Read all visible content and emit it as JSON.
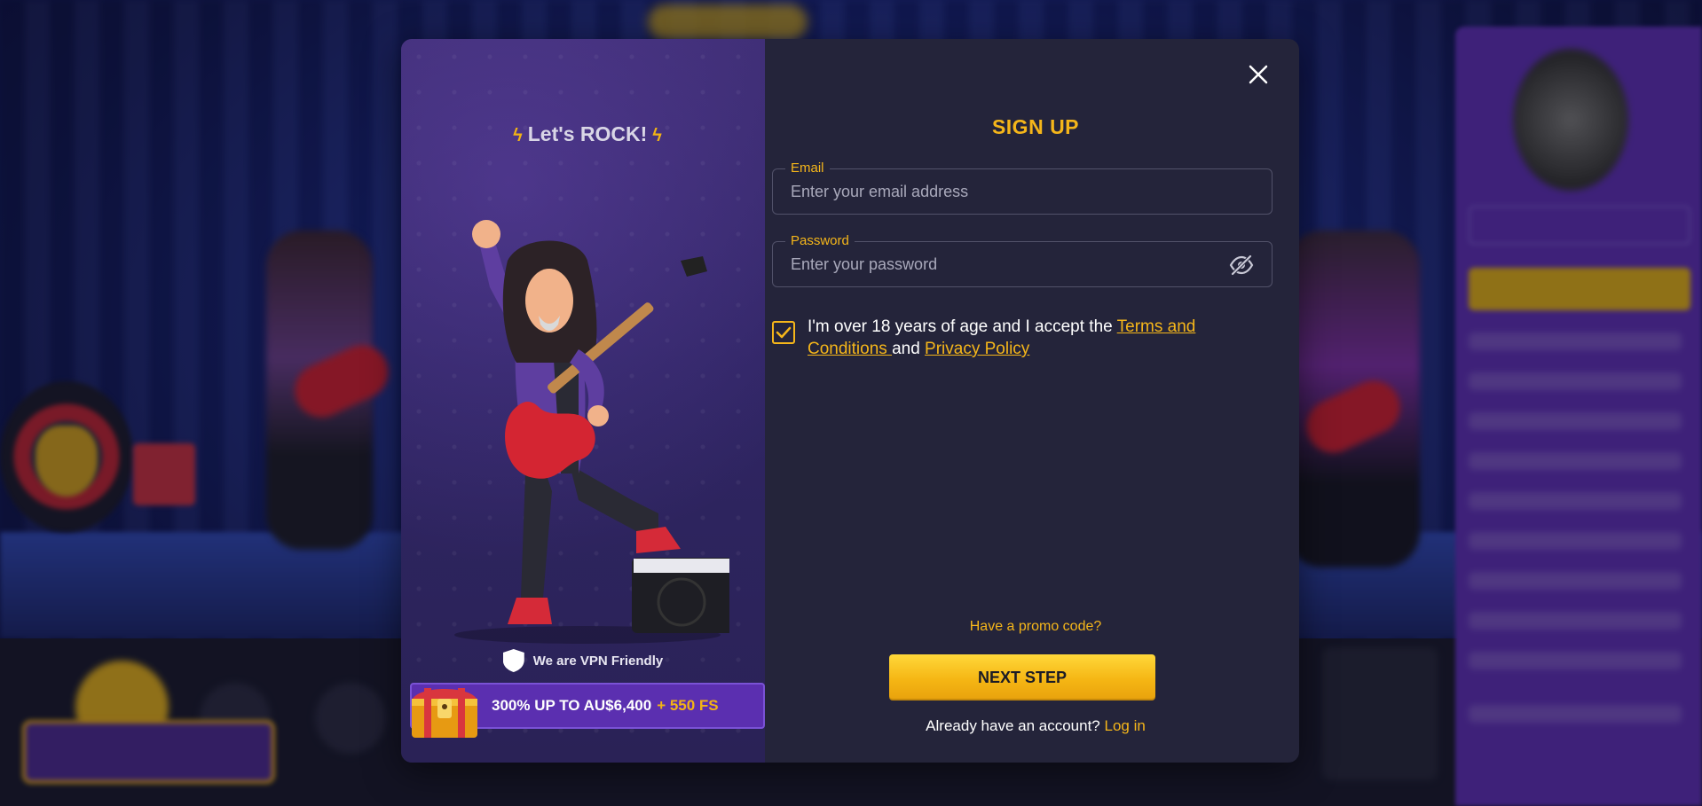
{
  "colors": {
    "accent": "#f5b61a",
    "modal_bg": "#24243a",
    "promo_panel": "#2f2563",
    "banner": "#5b2fb0"
  },
  "promo": {
    "headline": "Let's ROCK!",
    "bolt_icon": "lightning-icon",
    "vpn_text": "We are VPN Friendly",
    "vpn_icon": "vpn-shield-icon",
    "bonus_main": "300% UP TO AU$6,400",
    "bonus_fs": "+ 550 FS",
    "chest_icon": "treasure-chest-icon"
  },
  "form": {
    "title": "SIGN UP",
    "close_icon": "close-icon",
    "email": {
      "label": "Email",
      "placeholder": "Enter your email address",
      "value": ""
    },
    "password": {
      "label": "Password",
      "placeholder": "Enter your password",
      "value": "",
      "toggle_icon": "eye-slash-icon"
    },
    "consent": {
      "checked": true,
      "text_before": "I'm over 18 years of age and I accept the ",
      "terms_link": "Terms and Conditions ",
      "text_middle": "and ",
      "privacy_link": "Privacy Policy"
    },
    "promo_code_link": "Have a promo code?",
    "next_button": "NEXT STEP",
    "already_text": "Already have an account? ",
    "login_link": "Log in"
  }
}
